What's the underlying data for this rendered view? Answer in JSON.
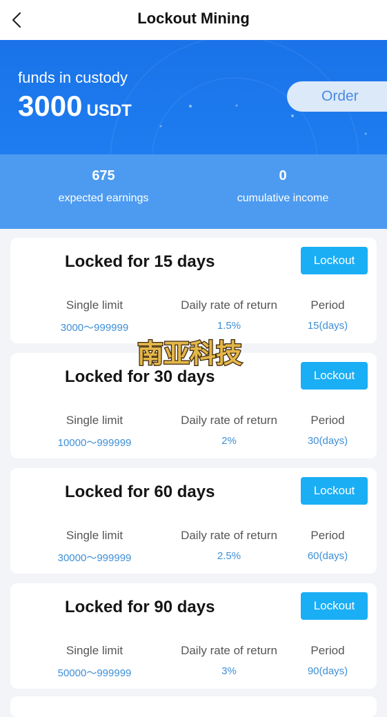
{
  "header": {
    "title": "Lockout Mining"
  },
  "hero": {
    "funds_label": "funds in custody",
    "funds_value": "3000",
    "funds_unit": "USDT",
    "order_label": "Order"
  },
  "stats": [
    {
      "value": "675",
      "label": "expected earnings"
    },
    {
      "value": "0",
      "label": "cumulative income"
    }
  ],
  "plans": [
    {
      "title": "Locked for 15 days",
      "button": "Lockout",
      "limit_label": "Single limit",
      "limit": "3000～999999",
      "rate_label": "Daily rate of return",
      "rate": "1.5%",
      "period_label": "Period",
      "period": "15(days)"
    },
    {
      "title": "Locked for 30 days",
      "button": "Lockout",
      "limit_label": "Single limit",
      "limit": "10000～999999",
      "rate_label": "Daily rate of return",
      "rate": "2%",
      "period_label": "Period",
      "period": "30(days)"
    },
    {
      "title": "Locked for 60 days",
      "button": "Lockout",
      "limit_label": "Single limit",
      "limit": "30000～999999",
      "rate_label": "Daily rate of return",
      "rate": "2.5%",
      "period_label": "Period",
      "period": "60(days)"
    },
    {
      "title": "Locked for 90 days",
      "button": "Lockout",
      "limit_label": "Single limit",
      "limit": "50000～999999",
      "rate_label": "Daily rate of return",
      "rate": "3%",
      "period_label": "Period",
      "period": "90(days)"
    }
  ],
  "watermark": {
    "text": "南亚科技"
  },
  "colors": {
    "primary_blue": "#1a73e8",
    "stats_blue": "#4d9bf0",
    "button_blue": "#1aaef5",
    "value_blue": "#3d8fd6"
  },
  "icons": {
    "back": "chevron-left-icon"
  }
}
